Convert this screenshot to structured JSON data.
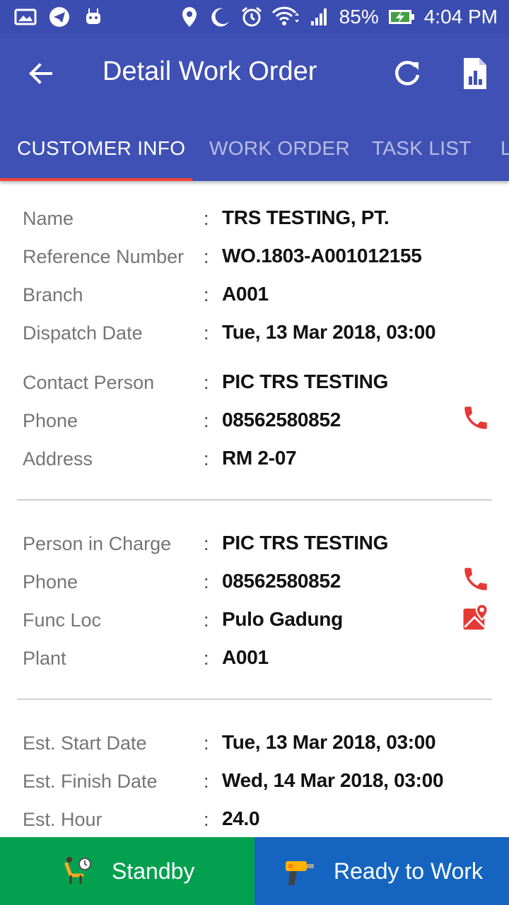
{
  "status_bar": {
    "battery": "85%",
    "time": "4:04 PM"
  },
  "app_bar": {
    "title": "Detail Work Order",
    "back_icon": "arrow-back-icon",
    "refresh_icon": "refresh-icon",
    "report_icon": "report-icon"
  },
  "tabs": [
    {
      "label": "CUSTOMER INFO",
      "active": true
    },
    {
      "label": "WORK ORDER",
      "active": false
    },
    {
      "label": "TASK LIST",
      "active": false
    },
    {
      "label": "L",
      "active": false
    }
  ],
  "colors": {
    "primary": "#3f51b5",
    "status_bar": "#3b4db1",
    "tab_indicator": "#f44336",
    "action_red": "#e53935",
    "standby_green": "#03a04f",
    "ready_blue": "#1565c0"
  },
  "sections": {
    "customer": [
      {
        "label": "Name",
        "value": "TRS TESTING, PT."
      },
      {
        "label": "Reference Number",
        "value": "WO.1803-A001012155"
      },
      {
        "label": "Branch",
        "value": "A001"
      },
      {
        "label": "Dispatch Date",
        "value": "Tue, 13 Mar 2018, 03:00"
      },
      {
        "label": "Contact Person",
        "value": "PIC TRS TESTING"
      },
      {
        "label": "Phone",
        "value": "08562580852",
        "action": "phone-icon"
      },
      {
        "label": "Address",
        "value": "RM 2-07"
      }
    ],
    "pic": [
      {
        "label": "Person in Charge",
        "value": "PIC TRS TESTING"
      },
      {
        "label": "Phone",
        "value": "08562580852",
        "action": "phone-icon"
      },
      {
        "label": "Func Loc",
        "value": "Pulo Gadung",
        "action": "map-icon"
      },
      {
        "label": "Plant",
        "value": "A001"
      }
    ],
    "estimate": [
      {
        "label": "Est. Start Date",
        "value": "Tue, 13 Mar 2018, 03:00"
      },
      {
        "label": "Est. Finish Date",
        "value": "Wed, 14 Mar 2018, 03:00"
      },
      {
        "label": "Est. Hour",
        "value": "24.0"
      }
    ]
  },
  "colon": ":",
  "buttons": {
    "standby": "Standby",
    "ready": "Ready to Work"
  }
}
